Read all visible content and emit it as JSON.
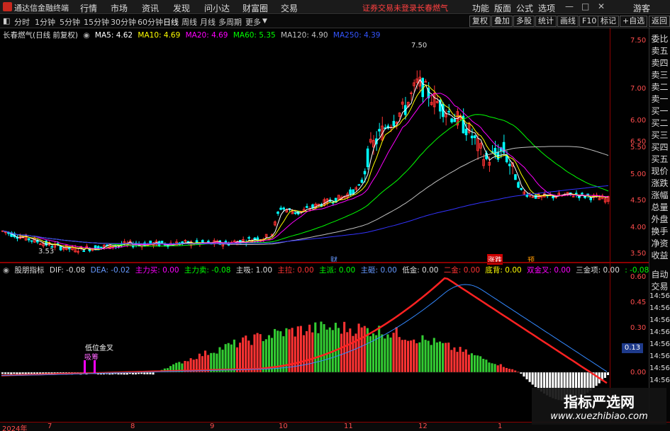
{
  "menubar": {
    "app_name": "通达信金融终端",
    "items": [
      "行情",
      "市场",
      "资讯",
      "发现",
      "问小达",
      "财富圈",
      "交易"
    ],
    "login_status": "证券交易未登录",
    "stock_name": "长春燃气",
    "right_items": [
      "功能",
      "版面",
      "公式",
      "选项"
    ],
    "guest": "游客"
  },
  "toolbar": {
    "periods": [
      "分时",
      "1分钟",
      "5分钟",
      "15分钟",
      "30分钟",
      "60分钟",
      "日线",
      "周线",
      "月线",
      "多周期",
      "更多"
    ],
    "selected_period": "日线",
    "right_buttons": [
      "复权",
      "叠加",
      "多股",
      "统计",
      "画线",
      "F10",
      "标记",
      "+自选",
      "返回"
    ]
  },
  "main_legend": {
    "title": "长春燃气(日线 前复权)",
    "ma5": "MA5: 4.62",
    "ma10": "MA10: 4.69",
    "ma20": "MA20: 4.69",
    "ma60": "MA60: 5.35",
    "ma120": "MA120: 4.90",
    "ma250": "MA250: 4.39"
  },
  "main_annotations": {
    "high": "7.50",
    "low": "3.53",
    "markers": [
      "财",
      "涨跌",
      "预"
    ]
  },
  "ind_legend": {
    "name": "股朋指标",
    "dif": "DIF: -0.08",
    "dea": "DEA: -0.02",
    "main_buy": "主力买: 0.00",
    "main_sell": "主力卖: -0.08",
    "main_absorb": "主吸: 1.00",
    "main_pull": "主拉: 0.00",
    "main_dispatch": "主派: 0.00",
    "main_smash": "主砸: 0.00",
    "low_gold": "低金: 0.00",
    "second_gold": "二金: 0.00",
    "divergence": "底背: 0.00",
    "double_gold": "双金叉: 0.00",
    "triple_gold": "三金项: 0.00",
    "tail": ": -0.08"
  },
  "ind_annotations": {
    "cross_label": "低位金叉",
    "absorb_label": "吸筹"
  },
  "axis_main": [
    "7.50",
    "7.00",
    "6.50",
    "6.00",
    "5.50",
    "5.00",
    "4.50",
    "4.00",
    "3.50"
  ],
  "axis_ind": [
    "0.60",
    "0.45",
    "0.30",
    "0.13",
    "0.00"
  ],
  "axis_ind_tag": "0.13",
  "side_panel": [
    "委比",
    "卖五",
    "卖四",
    "卖三",
    "卖二",
    "卖一",
    "买一",
    "买二",
    "买三",
    "买四",
    "买五",
    "现价",
    "涨跌",
    "涨幅",
    "总量",
    "外盘",
    "换手",
    "净资",
    "收益",
    "",
    "自动",
    "交易",
    "14:56",
    "14:56",
    "14:56",
    "14:56",
    "14:56",
    "14:56",
    "14:56",
    "14:56"
  ],
  "dates": [
    "2024年",
    "7",
    "8",
    "9",
    "10",
    "11",
    "12",
    "1"
  ],
  "watermark": {
    "line1": "指标严选网",
    "line2": "www.xuezhibiao.com"
  },
  "colors": {
    "ma5": "#ffffff",
    "ma10": "#ffff00",
    "ma20": "#ff00ff",
    "ma60": "#00ff00",
    "ma120": "#c0c0c0",
    "ma250": "#3333ff",
    "up": "#ff3333",
    "down": "#00ffff"
  }
}
